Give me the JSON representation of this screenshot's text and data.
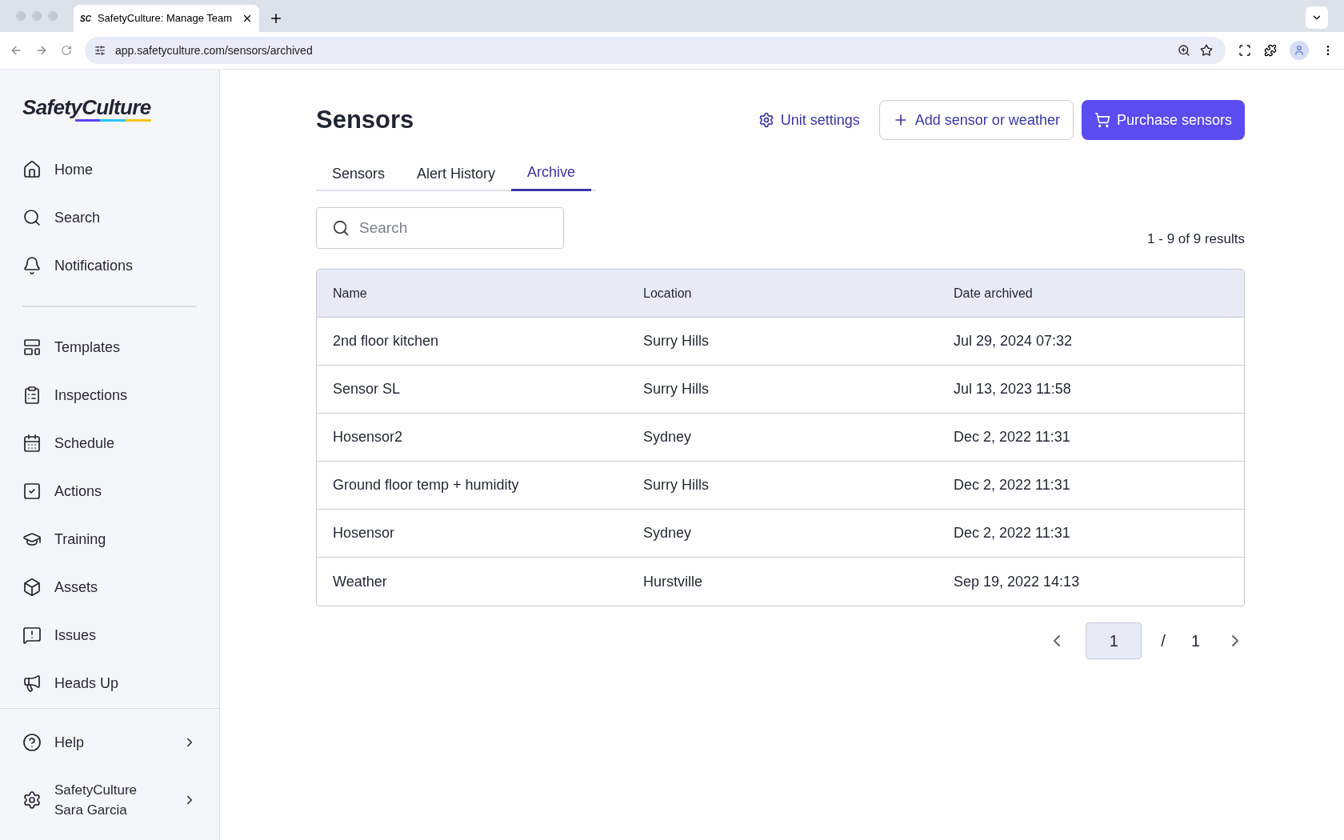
{
  "browser": {
    "tab_title": "SafetyCulture: Manage Team",
    "tab_favicon": "SC",
    "url": "app.safetyculture.com/sensors/archived"
  },
  "sidebar": {
    "logo": "SafetyCulture",
    "top_items": [
      "Home",
      "Search",
      "Notifications"
    ],
    "items": [
      "Templates",
      "Inspections",
      "Schedule",
      "Actions",
      "Training",
      "Assets",
      "Issues",
      "Heads Up"
    ],
    "help": "Help",
    "account": {
      "org": "SafetyCulture",
      "user": "Sara Garcia"
    }
  },
  "page": {
    "title": "Sensors",
    "unit_settings": "Unit settings",
    "add_button": "Add sensor or weather",
    "purchase_button": "Purchase sensors",
    "tabs": [
      {
        "label": "Sensors",
        "selected": false
      },
      {
        "label": "Alert History",
        "selected": false
      },
      {
        "label": "Archive",
        "selected": true
      }
    ],
    "search": {
      "placeholder": "Search"
    },
    "results": "1 - 9 of 9 results"
  },
  "table": {
    "columns": [
      "Name",
      "Location",
      "Date archived"
    ],
    "rows": [
      [
        "2nd floor kitchen",
        "Surry Hills",
        "Jul 29, 2024 07:32"
      ],
      [
        "Sensor SL",
        "Surry Hills",
        "Jul 13, 2023 11:58"
      ],
      [
        "Hosensor2",
        "Sydney",
        "Dec 2, 2022 11:31"
      ],
      [
        "Ground floor temp + humidity",
        "Surry Hills",
        "Dec 2, 2022 11:31"
      ],
      [
        "Hosensor",
        "Sydney",
        "Dec 2, 2022 11:31"
      ],
      [
        "Weather",
        "Hurstville",
        "Sep 19, 2022 14:13"
      ]
    ]
  },
  "pagination": {
    "current": "1",
    "separator": "/",
    "total": "1"
  }
}
